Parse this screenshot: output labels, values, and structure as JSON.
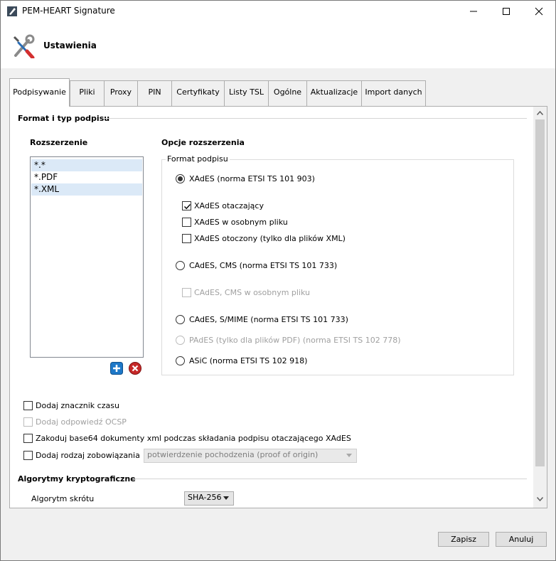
{
  "window": {
    "title": "PEM-HEART Signature",
    "icon": "pen-icon"
  },
  "header": {
    "title": "Ustawienia",
    "icon": "tools-icon"
  },
  "tabs": [
    {
      "label": "Podpisywanie",
      "active": true
    },
    {
      "label": "Pliki"
    },
    {
      "label": "Proxy"
    },
    {
      "label": "PIN"
    },
    {
      "label": "Certyfikaty"
    },
    {
      "label": "Listy TSL"
    },
    {
      "label": "Ogólne"
    },
    {
      "label": "Aktualizacje"
    },
    {
      "label": "Import danych"
    }
  ],
  "signing": {
    "section_title": "Format i typ podpisu",
    "extensions": {
      "title": "Rozszerzenie",
      "items": [
        {
          "label": "*.*",
          "selected": true
        },
        {
          "label": "*.PDF",
          "selected": false
        },
        {
          "label": "*.XML",
          "selected": true
        }
      ]
    },
    "options": {
      "title": "Opcje rozszerzenia",
      "group_label": "Format podpisu",
      "xades": {
        "label": "XAdES (norma ETSI TS 101 903)",
        "checked": true
      },
      "xades_enveloping": {
        "label": "XAdES otaczający",
        "checked": true
      },
      "xades_detached": {
        "label": "XAdES w osobnym pliku",
        "checked": false
      },
      "xades_enveloped": {
        "label": "XAdES otoczony (tylko dla plików XML)",
        "checked": false
      },
      "cades_cms": {
        "label": "CAdES, CMS  (norma ETSI TS 101 733)",
        "checked": false
      },
      "cades_cms_detached": {
        "label": "CAdES, CMS w osobnym pliku",
        "checked": false,
        "disabled": true
      },
      "cades_smime": {
        "label": "CAdES, S/MIME (norma ETSI TS 101 733)",
        "checked": false
      },
      "pades": {
        "label": "PAdES  (tylko dla plików PDF) (norma ETSI TS 102 778)",
        "checked": false,
        "disabled": true
      },
      "asic": {
        "label": "ASiC (norma ETSI TS 102 918)",
        "checked": false
      }
    },
    "timestamp": {
      "label": "Dodaj znacznik czasu",
      "checked": false
    },
    "ocsp": {
      "label": "Dodaj odpowiedź OCSP",
      "checked": false,
      "disabled": true
    },
    "base64": {
      "label": "Zakoduj base64 dokumenty xml podczas składania podpisu otaczającego XAdES",
      "checked": false
    },
    "commitment": {
      "label": "Dodaj rodzaj zobowiązania",
      "checked": false,
      "value": "potwierdzenie pochodzenia (proof of origin)",
      "disabled": true
    },
    "crypto": {
      "section_title": "Algorytmy kryptograficzne",
      "hash_label": "Algorytm skrótu",
      "hash_value": "SHA-256"
    }
  },
  "buttons": {
    "save": "Zapisz",
    "cancel": "Anuluj"
  },
  "colors": {
    "selection": "#dbe9f7",
    "add_icon": "#1e78c8",
    "remove_icon": "#c62828"
  }
}
